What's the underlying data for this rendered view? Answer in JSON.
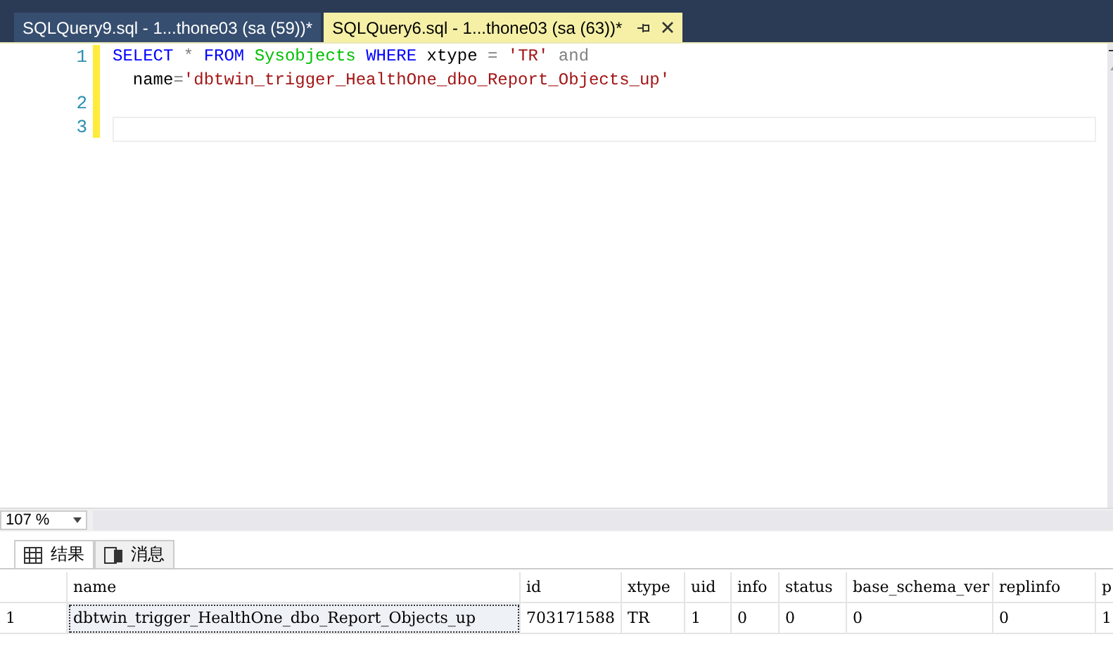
{
  "tabs": [
    {
      "label": "SQLQuery9.sql - 1...thone03 (sa (59))*",
      "selected": false
    },
    {
      "label": "SQLQuery6.sql - 1...thone03 (sa (63))*",
      "selected": true
    }
  ],
  "editor": {
    "lines": [
      {
        "number": "1",
        "tokens": [
          {
            "kind": "keyword",
            "text": "SELECT"
          },
          {
            "kind": "operator",
            "text": " * "
          },
          {
            "kind": "keyword",
            "text": "FROM"
          },
          {
            "kind": "object",
            "text": " Sysobjects "
          },
          {
            "kind": "keyword",
            "text": "WHERE"
          },
          {
            "kind": "plain",
            "text": " xtype "
          },
          {
            "kind": "operator",
            "text": "= "
          },
          {
            "kind": "string",
            "text": "'TR'"
          },
          {
            "kind": "operator",
            "text": " and"
          }
        ]
      },
      {
        "tokens": [
          {
            "kind": "plain",
            "text": "  name"
          },
          {
            "kind": "operator",
            "text": "="
          },
          {
            "kind": "string",
            "text": "'dbtwin_trigger_HealthOne_dbo_Report_Objects_up'"
          }
        ]
      },
      {
        "number": "2"
      },
      {
        "number": "3"
      }
    ]
  },
  "zoom": "107 %",
  "result_tabs": [
    {
      "label": "结果",
      "kind": "grid"
    },
    {
      "label": "消息",
      "kind": "messages"
    }
  ],
  "table": {
    "columns": [
      "name",
      "id",
      "xtype",
      "uid",
      "info",
      "status",
      "base_schema_ver",
      "replinfo",
      "p"
    ],
    "rows": [
      {
        "row_number": "1",
        "cells": [
          "dbtwin_trigger_HealthOne_dbo_Report_Objects_up",
          "703171588",
          "TR",
          "1",
          "0",
          "0",
          "0",
          "0",
          "1"
        ]
      }
    ]
  }
}
